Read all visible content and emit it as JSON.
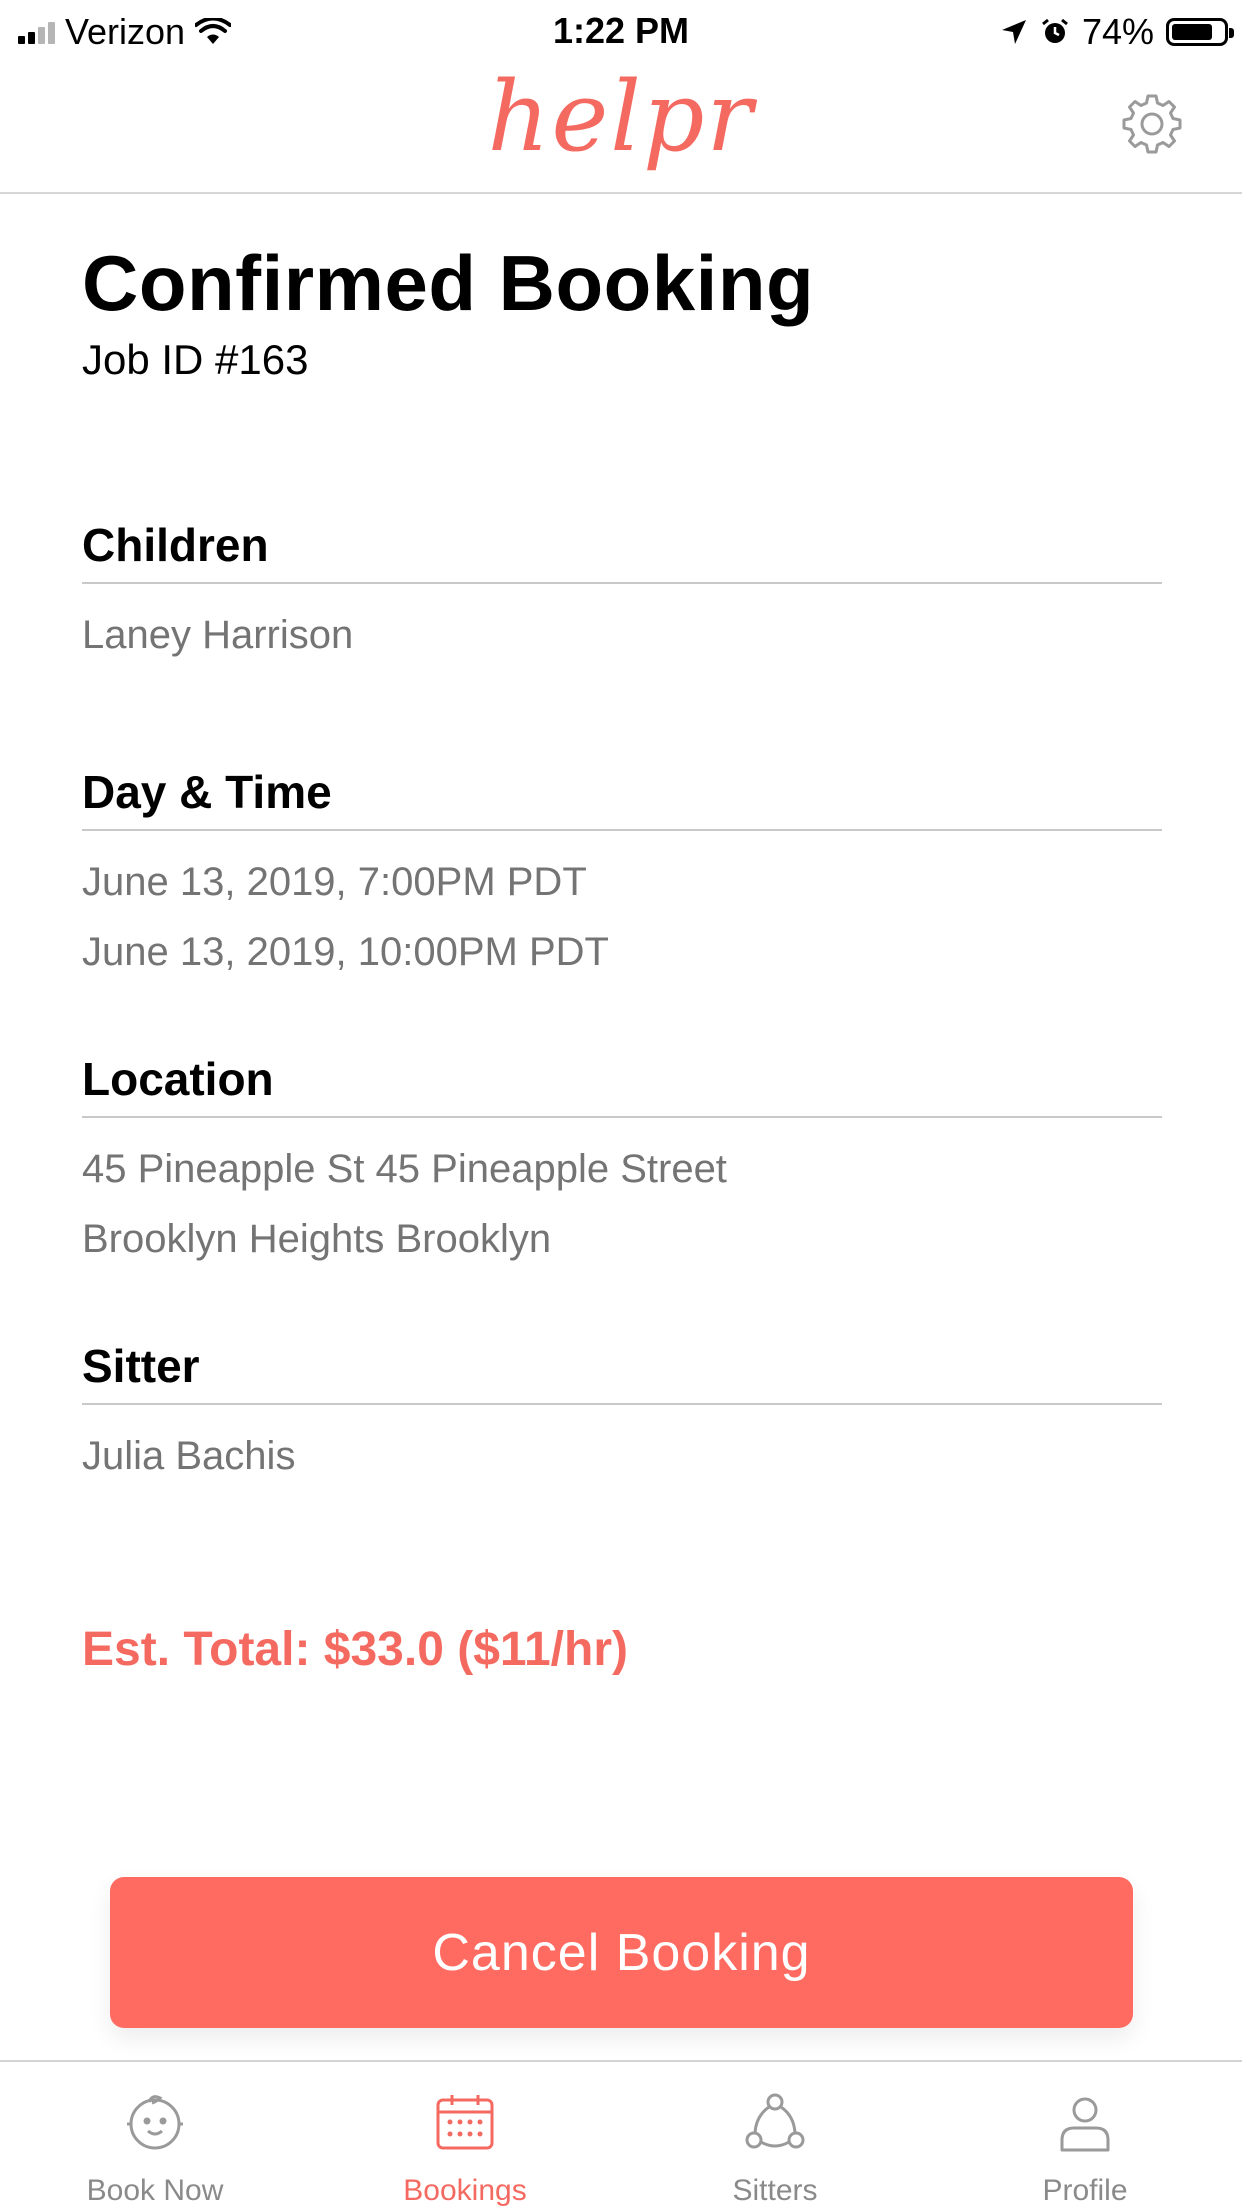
{
  "status_bar": {
    "carrier": "Verizon",
    "time": "1:22 PM",
    "battery_percent": "74%",
    "battery_level": 0.74,
    "icons": [
      "signal-icon",
      "wifi-icon",
      "location-arrow-icon",
      "alarm-icon",
      "battery-icon"
    ]
  },
  "header": {
    "logo_text": "helpr",
    "brand_color": "#f46a60",
    "settings_icon": "gear-icon"
  },
  "booking": {
    "title": "Confirmed Booking",
    "job_id": "Job ID #163",
    "sections": {
      "children": {
        "heading": "Children",
        "values": [
          "Laney Harrison"
        ]
      },
      "day_time": {
        "heading": "Day & Time",
        "values": [
          "June 13, 2019, 7:00PM PDT",
          "June 13, 2019, 10:00PM PDT"
        ]
      },
      "location": {
        "heading": "Location",
        "values": [
          "45 Pineapple St 45 Pineapple Street",
          "Brooklyn Heights Brooklyn"
        ]
      },
      "sitter": {
        "heading": "Sitter",
        "values": [
          "Julia Bachis"
        ]
      }
    },
    "est_total": "Est. Total: $33.0 ($11/hr)",
    "cancel_button": "Cancel Booking",
    "button_color": "#ff6b61"
  },
  "tabbar": {
    "active": "bookings",
    "tabs": [
      {
        "id": "book_now",
        "label": "Book Now",
        "icon": "baby-face-icon"
      },
      {
        "id": "bookings",
        "label": "Bookings",
        "icon": "calendar-icon"
      },
      {
        "id": "sitters",
        "label": "Sitters",
        "icon": "group-network-icon"
      },
      {
        "id": "profile",
        "label": "Profile",
        "icon": "person-icon"
      }
    ]
  }
}
